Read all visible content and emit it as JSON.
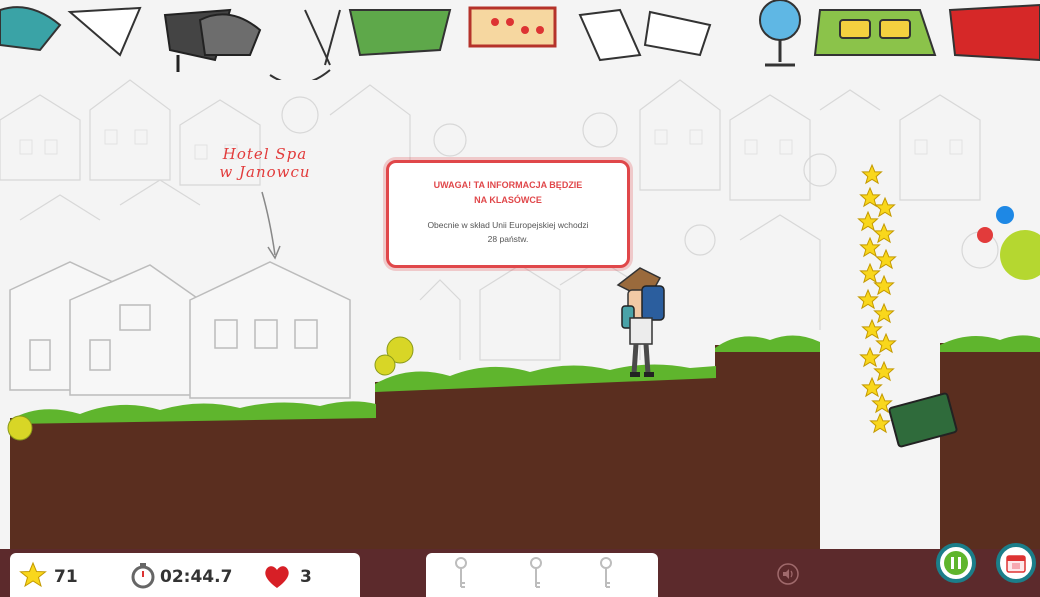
{
  "landmark": {
    "line1": "Hotel Spa",
    "line2": "w Janowcu"
  },
  "popup": {
    "title_line1": "UWAGA! TA INFORMACJA BĘDZIE",
    "title_line2": "NA KLASÓWCE",
    "body_line1": "Obecnie w skład Unii Europejskiej wchodzi",
    "body_line2": "28 państw."
  },
  "hud": {
    "stars": "71",
    "timer": "02:44.7",
    "lives": "3",
    "keys_collected": 0,
    "keys_total": 3
  },
  "colors": {
    "accent_red": "#e0474a",
    "ground": "#5a2e1f",
    "grass": "#5fb52d",
    "hud_bar": "#5c2a2c",
    "button_ring": "#1b7e8a"
  }
}
